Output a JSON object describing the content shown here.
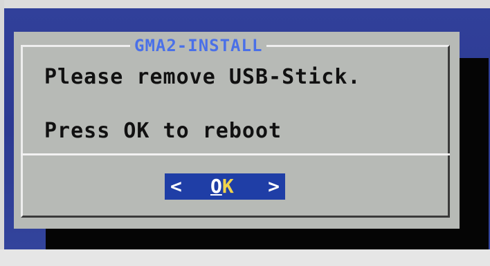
{
  "dialog": {
    "title": "GMA2-INSTALL",
    "message_line1": "Please remove USB-Stick.",
    "message_line2": "Press OK to reboot"
  },
  "button": {
    "left_bracket": "<",
    "label_first": "O",
    "label_rest": "K",
    "right_bracket": ">"
  },
  "colors": {
    "background": "#2a3c8e",
    "dialog": "#b7bab6",
    "title": "#4a70e8",
    "button": "#1f3ea6",
    "button_hotkey": "#f1d34a"
  }
}
